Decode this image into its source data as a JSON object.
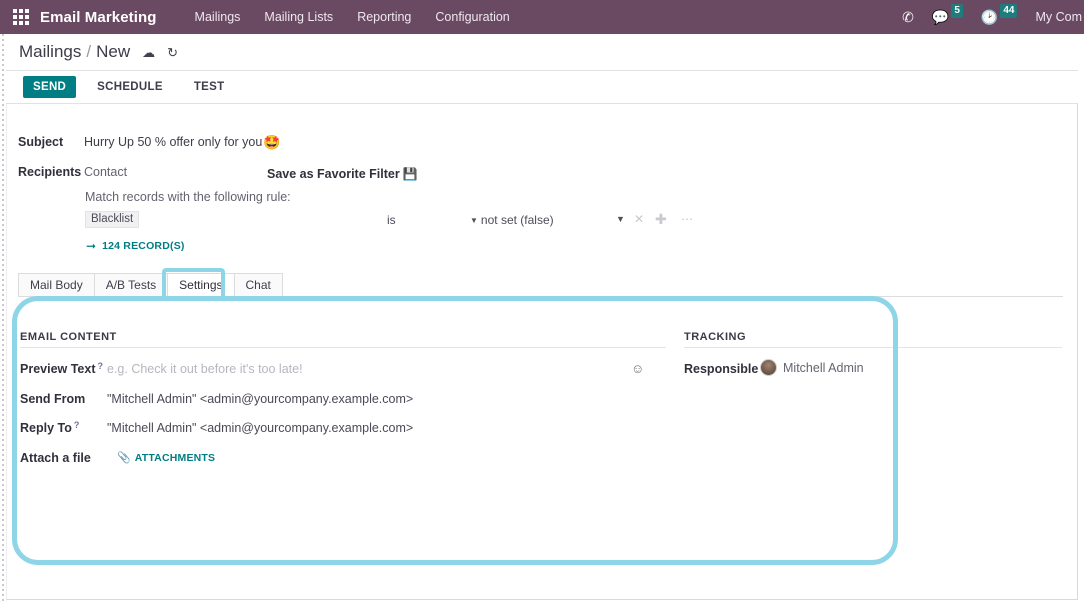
{
  "navbar": {
    "apps_icon": "apps-grid-icon",
    "app_title": "Email Marketing",
    "menu": [
      {
        "label": "Mailings"
      },
      {
        "label": "Mailing Lists"
      },
      {
        "label": "Reporting"
      },
      {
        "label": "Configuration"
      }
    ],
    "right": {
      "phone_icon": "telephone-icon",
      "messages_icon": "chat-bubble-icon",
      "messages_count": "5",
      "activities_icon": "clock-icon",
      "activities_count": "44",
      "user_name": "My Com",
      "badge_color": "#1d7c7c",
      "bar_color": "#6a4a63"
    }
  },
  "control_panel": {
    "breadcrumb_parent": "Mailings",
    "breadcrumb_separator": "/",
    "breadcrumb_current": "New",
    "save_icon": "cloud-upload-icon",
    "discard_icon": "undo-icon"
  },
  "statusbar": {
    "buttons": [
      {
        "label": "SEND",
        "primary": true
      },
      {
        "label": "SCHEDULE",
        "primary": false
      },
      {
        "label": "TEST",
        "primary": false
      }
    ],
    "primary_color": "#017e84"
  },
  "form": {
    "subject_label": "Subject",
    "subject_value": "Hurry Up 50 % offer only for you",
    "subject_emoji": "🤩",
    "recipients_label": "Recipients",
    "recipients_value": "Contact",
    "save_filter_label": "Save as Favorite Filter",
    "save_filter_icon": "floppy-disk-icon",
    "match_rule_text": "Match records with the following rule:",
    "rule": {
      "field": "Blacklist",
      "operator": "is",
      "value": "not set (false)",
      "caret_icon": "chevron-down-icon",
      "remove_icon": "remove-node-icon",
      "add_icon": "add-node-icon",
      "more_icon": "more-options-icon"
    },
    "records_arrow_icon": "arrow-right-icon",
    "records_label": "124 RECORD(S)"
  },
  "notebook": {
    "tabs": [
      {
        "label": "Mail Body",
        "active": false
      },
      {
        "label": "A/B Tests",
        "active": false
      },
      {
        "label": "Settings",
        "active": true
      },
      {
        "label": "Chat",
        "active": false
      }
    ]
  },
  "settings": {
    "email_content": {
      "title": "EMAIL CONTENT",
      "preview_label": "Preview Text",
      "preview_help": "?",
      "preview_placeholder": "e.g. Check it out before it's too late!",
      "emoji_picker_icon": "smiley-face-icon",
      "send_from_label": "Send From",
      "send_from_value": "\"Mitchell Admin\" <admin@yourcompany.example.com>",
      "reply_to_label": "Reply To",
      "reply_to_help": "?",
      "reply_to_value": "\"Mitchell Admin\" <admin@yourcompany.example.com>",
      "attach_label": "Attach a file",
      "attach_icon": "paperclip-icon",
      "attachments_label": "ATTACHMENTS"
    },
    "tracking": {
      "title": "TRACKING",
      "responsible_label": "Responsible",
      "responsible_avatar": "user-avatar",
      "responsible_value": "Mitchell Admin"
    }
  },
  "annotations": {
    "color": "#8ed5e8",
    "panel_highlight": "settings-panel-highlight",
    "tab_highlight": "settings-tab-highlight"
  }
}
